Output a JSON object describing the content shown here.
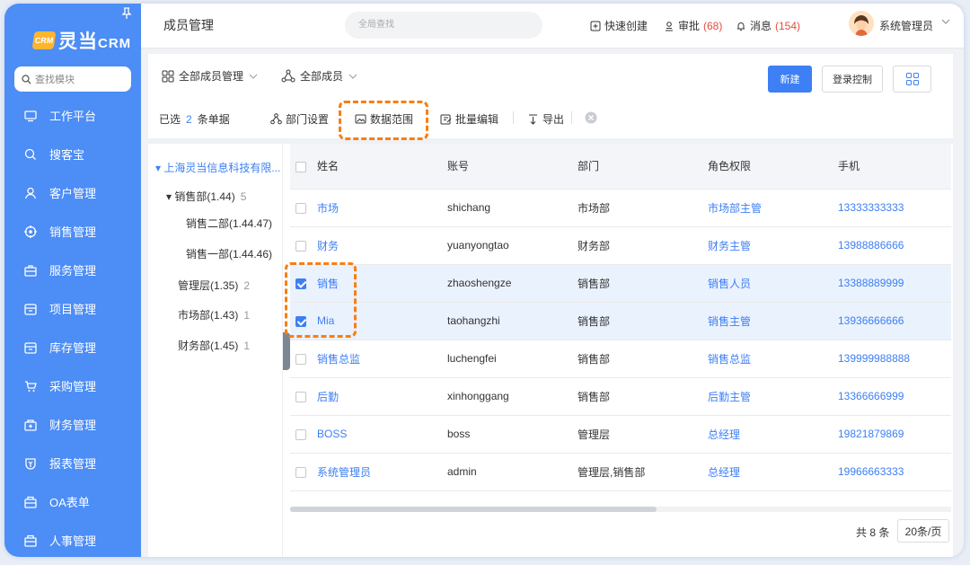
{
  "sidebar": {
    "logo_mark": "CRM",
    "logo_text": "灵当",
    "logo_suffix": "CRM",
    "search_placeholder": "查找模块",
    "items": [
      {
        "label": "工作平台",
        "icon": "monitor-icon"
      },
      {
        "label": "搜客宝",
        "icon": "search-icon"
      },
      {
        "label": "客户管理",
        "icon": "user-icon"
      },
      {
        "label": "销售管理",
        "icon": "target-icon"
      },
      {
        "label": "服务管理",
        "icon": "briefcase-icon"
      },
      {
        "label": "项目管理",
        "icon": "folder-icon"
      },
      {
        "label": "库存管理",
        "icon": "box-icon"
      },
      {
        "label": "采购管理",
        "icon": "cart-icon"
      },
      {
        "label": "财务管理",
        "icon": "wallet-icon"
      },
      {
        "label": "报表管理",
        "icon": "report-icon"
      },
      {
        "label": "OA表单",
        "icon": "form-icon"
      },
      {
        "label": "人事管理",
        "icon": "people-icon"
      }
    ]
  },
  "topbar": {
    "title": "成员管理",
    "search_placeholder": "全局查找",
    "quick_create": "快速创建",
    "approval": "审批",
    "approval_count": "(68)",
    "messages": "消息",
    "messages_count": "(154)",
    "user": "系统管理员"
  },
  "filters": {
    "member_scope": "全部成员管理",
    "member_type": "全部成员"
  },
  "buttons": {
    "new": "新建",
    "login_control": "登录控制"
  },
  "actions": {
    "selected_prefix": "已选",
    "selected_count": "2",
    "selected_suffix": "条单据",
    "dept_settings": "部门设置",
    "data_scope": "数据范围",
    "batch_edit": "批量编辑",
    "export": "导出"
  },
  "tree": {
    "root": "上海灵当信息科技有限...",
    "items": [
      {
        "label": "销售部(1.44)",
        "count": "5"
      },
      {
        "label": "销售二部(1.44.47)",
        "count": ""
      },
      {
        "label": "销售一部(1.44.46)",
        "count": ""
      },
      {
        "label": "管理层(1.35)",
        "count": "2"
      },
      {
        "label": "市场部(1.43)",
        "count": "1"
      },
      {
        "label": "财务部(1.45)",
        "count": "1"
      }
    ]
  },
  "table": {
    "columns": [
      "姓名",
      "账号",
      "部门",
      "角色权限",
      "手机"
    ],
    "rows": [
      {
        "selected": false,
        "name": "市场",
        "account": "shichang",
        "dept": "市场部",
        "role": "市场部主管",
        "phone": "13333333333"
      },
      {
        "selected": false,
        "name": "财务",
        "account": "yuanyongtao",
        "dept": "财务部",
        "role": "财务主管",
        "phone": "13988886666"
      },
      {
        "selected": true,
        "name": "销售",
        "account": "zhaoshengze",
        "dept": "销售部",
        "role": "销售人员",
        "phone": "13388889999"
      },
      {
        "selected": true,
        "name": "Mia",
        "account": "taohangzhi",
        "dept": "销售部",
        "role": "销售主管",
        "phone": "13936666666"
      },
      {
        "selected": false,
        "name": "销售总监",
        "account": "luchengfei",
        "dept": "销售部",
        "role": "销售总监",
        "phone": "139999988888"
      },
      {
        "selected": false,
        "name": "后勤",
        "account": "xinhonggang",
        "dept": "销售部",
        "role": "后勤主管",
        "phone": "13366666999"
      },
      {
        "selected": false,
        "name": "BOSS",
        "account": "boss",
        "dept": "管理层",
        "role": "总经理",
        "phone": "19821879869"
      },
      {
        "selected": false,
        "name": "系统管理员",
        "account": "admin",
        "dept": "管理层,销售部",
        "role": "总经理",
        "phone": "19966663333"
      }
    ]
  },
  "pager": {
    "total": "共 8 条",
    "page_size": "20条/页"
  },
  "colors": {
    "sidebar": "#4c8df6",
    "accent": "#3d7ff4",
    "highlight": "#f57f17",
    "selected_row": "#eaf2fd"
  }
}
